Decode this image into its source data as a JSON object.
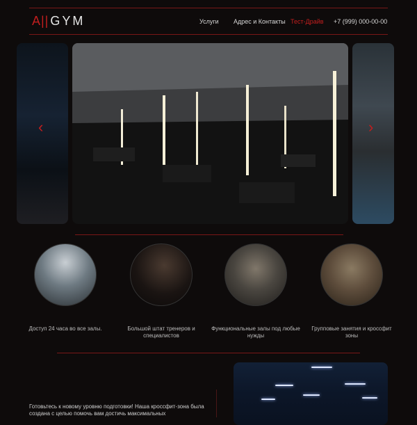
{
  "header": {
    "logo_mark": "A||",
    "logo_text": "GYM",
    "nav": [
      "Услуги",
      "Адрес и Контакты",
      "Тест-Драйв"
    ],
    "phone": "+7 (999) 000-00-00",
    "accent_color": "#c21e1e"
  },
  "carousel": {
    "prev_icon": "chevron-left-icon",
    "next_icon": "chevron-right-icon",
    "prev_glyph": "‹",
    "next_glyph": "›"
  },
  "features": [
    {
      "caption": "Доступ 24 часа во все залы."
    },
    {
      "caption": "Большой штат тренеров и специалистов"
    },
    {
      "caption": "Функциональные залы под любые нужды"
    },
    {
      "caption": "Групповые занятия и кроссфит зоны"
    }
  ],
  "intro": {
    "text": "Готовьтесь к новому уровню подготовки! Наша кроссфит-зона была создана с целью помочь вам достичь максимальных"
  }
}
